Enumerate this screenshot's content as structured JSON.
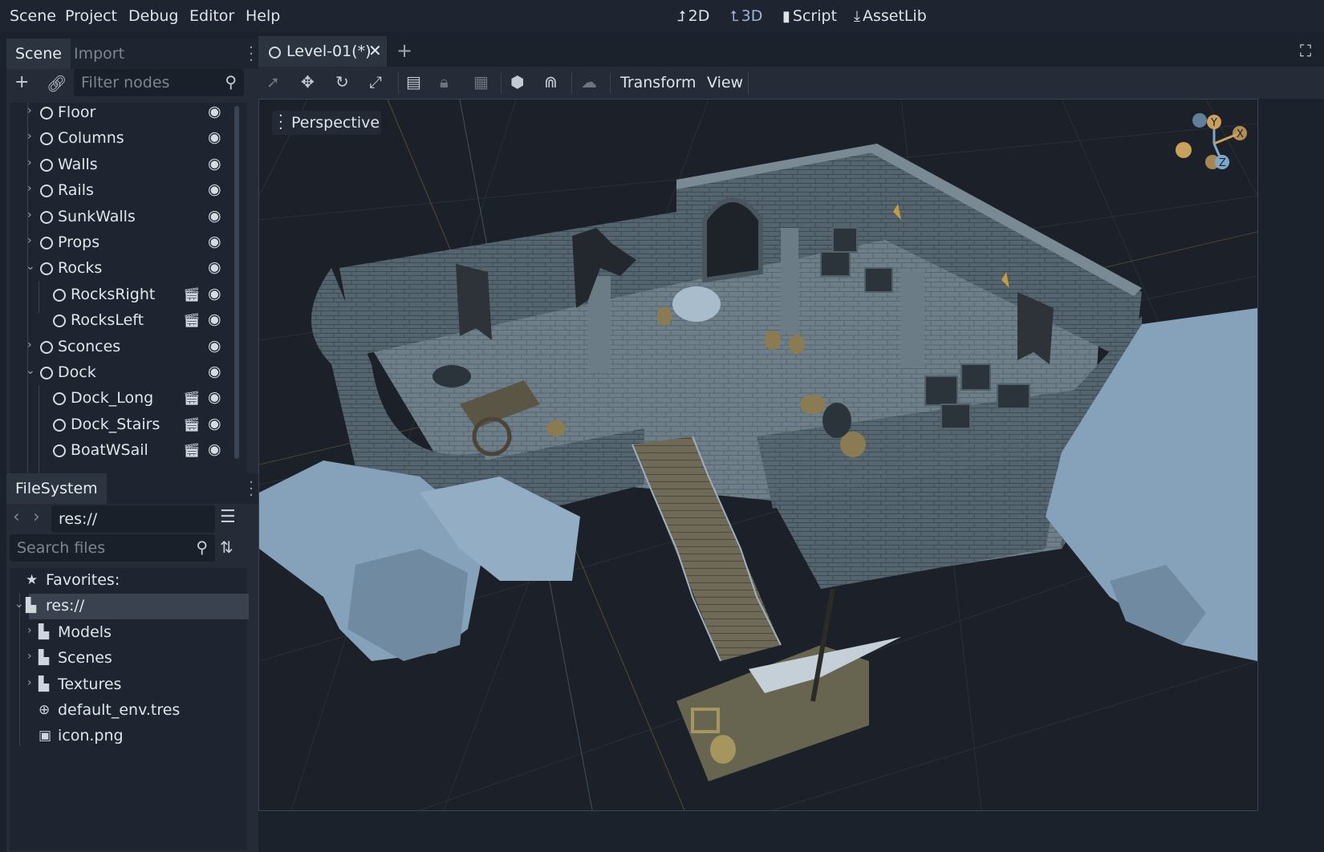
{
  "menubar": {
    "items": [
      "Scene",
      "Project",
      "Debug",
      "Editor",
      "Help"
    ],
    "main_tabs": [
      {
        "label": "2D",
        "icon": "2d-icon"
      },
      {
        "label": "3D",
        "icon": "3d-icon"
      },
      {
        "label": "Script",
        "icon": "script-icon"
      },
      {
        "label": "AssetLib",
        "icon": "assetlib-icon"
      }
    ],
    "active_tab": "3D"
  },
  "scene_dock": {
    "tabs": [
      "Scene",
      "Import"
    ],
    "filter_placeholder": "Filter nodes",
    "nodes": [
      {
        "label": "Floor",
        "depth": 0,
        "expanded": false,
        "scene_instance": false
      },
      {
        "label": "Columns",
        "depth": 0,
        "expanded": false,
        "scene_instance": false
      },
      {
        "label": "Walls",
        "depth": 0,
        "expanded": false,
        "scene_instance": false
      },
      {
        "label": "Rails",
        "depth": 0,
        "expanded": false,
        "scene_instance": false
      },
      {
        "label": "SunkWalls",
        "depth": 0,
        "expanded": false,
        "scene_instance": false
      },
      {
        "label": "Props",
        "depth": 0,
        "expanded": false,
        "scene_instance": false
      },
      {
        "label": "Rocks",
        "depth": 0,
        "expanded": true,
        "scene_instance": false
      },
      {
        "label": "RocksRight",
        "depth": 1,
        "expanded": null,
        "scene_instance": true
      },
      {
        "label": "RocksLeft",
        "depth": 1,
        "expanded": null,
        "scene_instance": true
      },
      {
        "label": "Sconces",
        "depth": 0,
        "expanded": false,
        "scene_instance": false
      },
      {
        "label": "Dock",
        "depth": 0,
        "expanded": true,
        "scene_instance": false
      },
      {
        "label": "Dock_Long",
        "depth": 1,
        "expanded": null,
        "scene_instance": true
      },
      {
        "label": "Dock_Stairs",
        "depth": 1,
        "expanded": null,
        "scene_instance": true
      },
      {
        "label": "BoatWSail",
        "depth": 1,
        "expanded": null,
        "scene_instance": true
      }
    ]
  },
  "filesystem_dock": {
    "title": "FileSystem",
    "path": "res://",
    "search_placeholder": "Search files",
    "items": [
      {
        "label": "Favorites:",
        "icon": "star-icon",
        "depth": 0,
        "arrow": null
      },
      {
        "label": "res://",
        "icon": "folder-icon",
        "depth": 0,
        "arrow": "expanded",
        "selected": true
      },
      {
        "label": "Models",
        "icon": "folder-icon",
        "depth": 1,
        "arrow": "collapsed"
      },
      {
        "label": "Scenes",
        "icon": "folder-icon",
        "depth": 1,
        "arrow": "collapsed"
      },
      {
        "label": "Textures",
        "icon": "folder-icon",
        "depth": 1,
        "arrow": "collapsed"
      },
      {
        "label": "default_env.tres",
        "icon": "globe-icon",
        "depth": 1,
        "arrow": null
      },
      {
        "label": "icon.png",
        "icon": "image-icon",
        "depth": 1,
        "arrow": null
      }
    ]
  },
  "editor": {
    "open_tab": "Level-01(*)",
    "toolbar_menus": [
      "Transform",
      "View"
    ],
    "viewport_label": "Perspective",
    "gizmo_axes": [
      "Y",
      "X",
      "Z"
    ],
    "colors": {
      "accent": "#9fb3d6",
      "gizmo_y": "#7ea8c9",
      "gizmo_x": "#c9a15b",
      "gizmo_z": "#7ea8c9"
    }
  }
}
